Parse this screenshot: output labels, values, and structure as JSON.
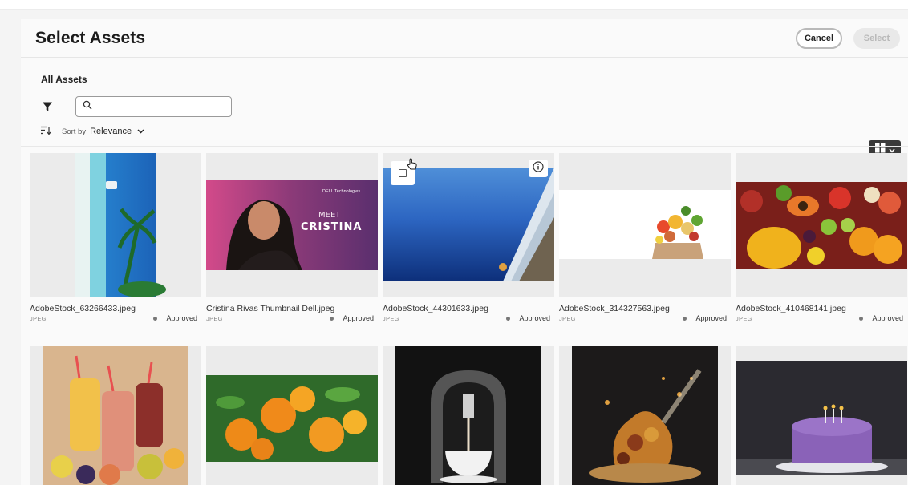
{
  "dialog": {
    "title": "Select Assets",
    "cancel_label": "Cancel",
    "select_label": "Select"
  },
  "browser": {
    "section_label": "All Assets",
    "search": {
      "placeholder": "",
      "value": ""
    },
    "sort": {
      "label": "Sort by",
      "value": "Relevance"
    }
  },
  "assets": [
    {
      "name": "AdobeStock_63266433.jpeg",
      "type": "JPEG",
      "status": "Approved",
      "status_color": "#777777"
    },
    {
      "name": "Cristina Rivas Thumbnail Dell.jpeg",
      "type": "JPEG",
      "status": "Approved",
      "status_color": "#777777"
    },
    {
      "name": "AdobeStock_44301633.jpeg",
      "type": "JPEG",
      "status": "Approved",
      "status_color": "#777777"
    },
    {
      "name": "AdobeStock_314327563.jpeg",
      "type": "JPEG",
      "status": "Approved",
      "status_color": "#777777"
    },
    {
      "name": "AdobeStock_410468141.jpeg",
      "type": "JPEG",
      "status": "Approved",
      "status_color": "#777777"
    }
  ],
  "thumbnail_text": {
    "meet": "MEET",
    "cristina": "CRISTINA",
    "brand": "DELL Technologies"
  }
}
